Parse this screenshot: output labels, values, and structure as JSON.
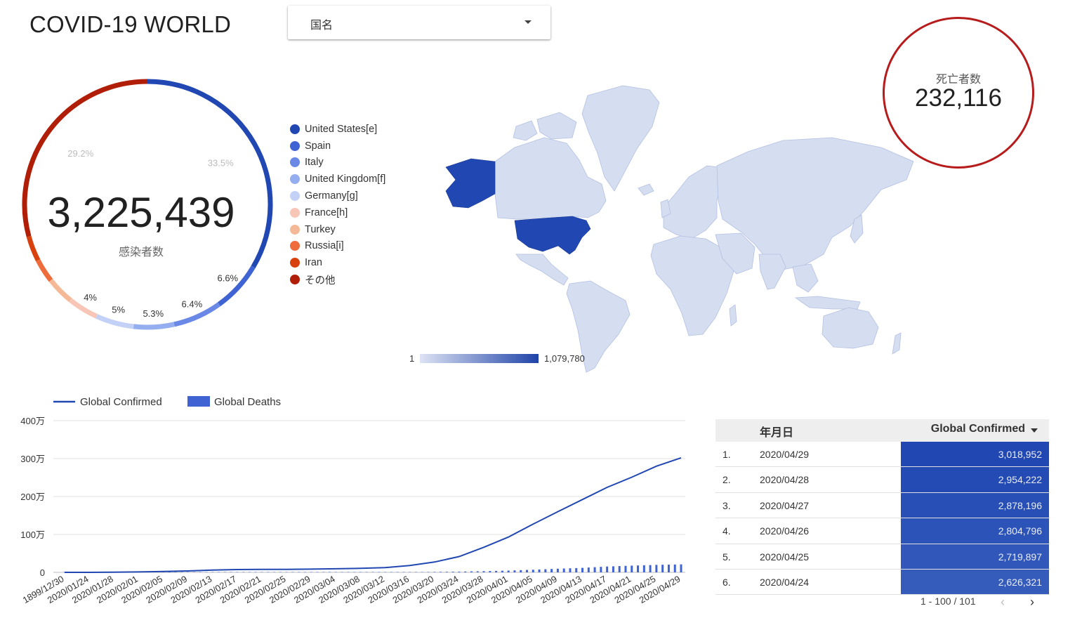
{
  "title": "COVID-19 WORLD",
  "filter": {
    "label": "国名"
  },
  "donut": {
    "total": "3,225,439",
    "label": "感染者数",
    "slices": [
      {
        "name": "United States[e]",
        "pct": 33.5,
        "label": "33.5%",
        "color": "#2148b2"
      },
      {
        "name": "Spain",
        "pct": 6.6,
        "label": "6.6%",
        "color": "#3f63d2"
      },
      {
        "name": "Italy",
        "pct": 6.4,
        "label": "6.4%",
        "color": "#6a88e5"
      },
      {
        "name": "United Kingdom[f]",
        "pct": 5.3,
        "label": "5.3%",
        "color": "#95aef0"
      },
      {
        "name": "Germany[g]",
        "pct": 5.0,
        "label": "5%",
        "color": "#c4d1f6"
      },
      {
        "name": "France[h]",
        "pct": 4.0,
        "label": "4%",
        "color": "#f7c6b6"
      },
      {
        "name": "Turkey",
        "pct": 3.6,
        "label": "",
        "color": "#f5b997"
      },
      {
        "name": "Russia[i]",
        "pct": 3.1,
        "label": "",
        "color": "#ee6b3b"
      },
      {
        "name": "Iran",
        "pct": 3.3,
        "label": "",
        "color": "#d8400d"
      },
      {
        "name": "その他",
        "pct": 29.2,
        "label": "29.2%",
        "color": "#b01e07"
      }
    ]
  },
  "map": {
    "scale_min": "1",
    "scale_max": "1,079,780",
    "colors": {
      "low": "#d5ddf0",
      "border": "#b3c0e2",
      "high": "#2148b2"
    }
  },
  "deaths": {
    "label": "死亡者数",
    "value": "232,116"
  },
  "chart_data": {
    "type": "line",
    "x": [
      "1899/12/30",
      "2020/01/24",
      "2020/01/28",
      "2020/02/01",
      "2020/02/05",
      "2020/02/09",
      "2020/02/13",
      "2020/02/17",
      "2020/02/21",
      "2020/02/25",
      "2020/02/29",
      "2020/03/04",
      "2020/03/08",
      "2020/03/12",
      "2020/03/16",
      "2020/03/20",
      "2020/03/24",
      "2020/03/28",
      "2020/04/01",
      "2020/04/05",
      "2020/04/09",
      "2020/04/13",
      "2020/04/17",
      "2020/04/21",
      "2020/04/25",
      "2020/04/29"
    ],
    "series": [
      {
        "name": "Global Confirmed",
        "kind": "line",
        "color": "#2148b2",
        "values": [
          0,
          900,
          5500,
          12000,
          24500,
          37600,
          60000,
          73300,
          77000,
          80400,
          86000,
          94000,
          105800,
          126000,
          182000,
          272000,
          417000,
          662000,
          932000,
          1272000,
          1600000,
          1920000,
          2240000,
          2510000,
          2800000,
          3020000
        ]
      },
      {
        "name": "Global Deaths",
        "kind": "bar",
        "color": "#3f63d2",
        "values": [
          0,
          20,
          130,
          260,
          560,
          810,
          1370,
          1870,
          2250,
          2700,
          2980,
          3350,
          3800,
          4720,
          7140,
          11300,
          18900,
          30900,
          47200,
          69400,
          95700,
          119000,
          154000,
          177000,
          197000,
          211000
        ]
      }
    ],
    "y_ticks": [
      "400万",
      "300万",
      "200万",
      "100万",
      "0"
    ],
    "ylim": [
      0,
      4000000
    ],
    "legend_position": "top-left",
    "grid": true
  },
  "table": {
    "col_date": "年月日",
    "col_value": "Global Confirmed",
    "rows": [
      {
        "idx": "1.",
        "date": "2020/04/29",
        "value": "3,018,952",
        "num": 3018952
      },
      {
        "idx": "2.",
        "date": "2020/04/28",
        "value": "2,954,222",
        "num": 2954222
      },
      {
        "idx": "3.",
        "date": "2020/04/27",
        "value": "2,878,196",
        "num": 2878196
      },
      {
        "idx": "4.",
        "date": "2020/04/26",
        "value": "2,804,796",
        "num": 2804796
      },
      {
        "idx": "5.",
        "date": "2020/04/25",
        "value": "2,719,897",
        "num": 2719897
      },
      {
        "idx": "6.",
        "date": "2020/04/24",
        "value": "2,626,321",
        "num": 2626321
      }
    ],
    "pager": {
      "range": "1 - 100 / 101",
      "prev": "‹",
      "next": "›"
    }
  }
}
